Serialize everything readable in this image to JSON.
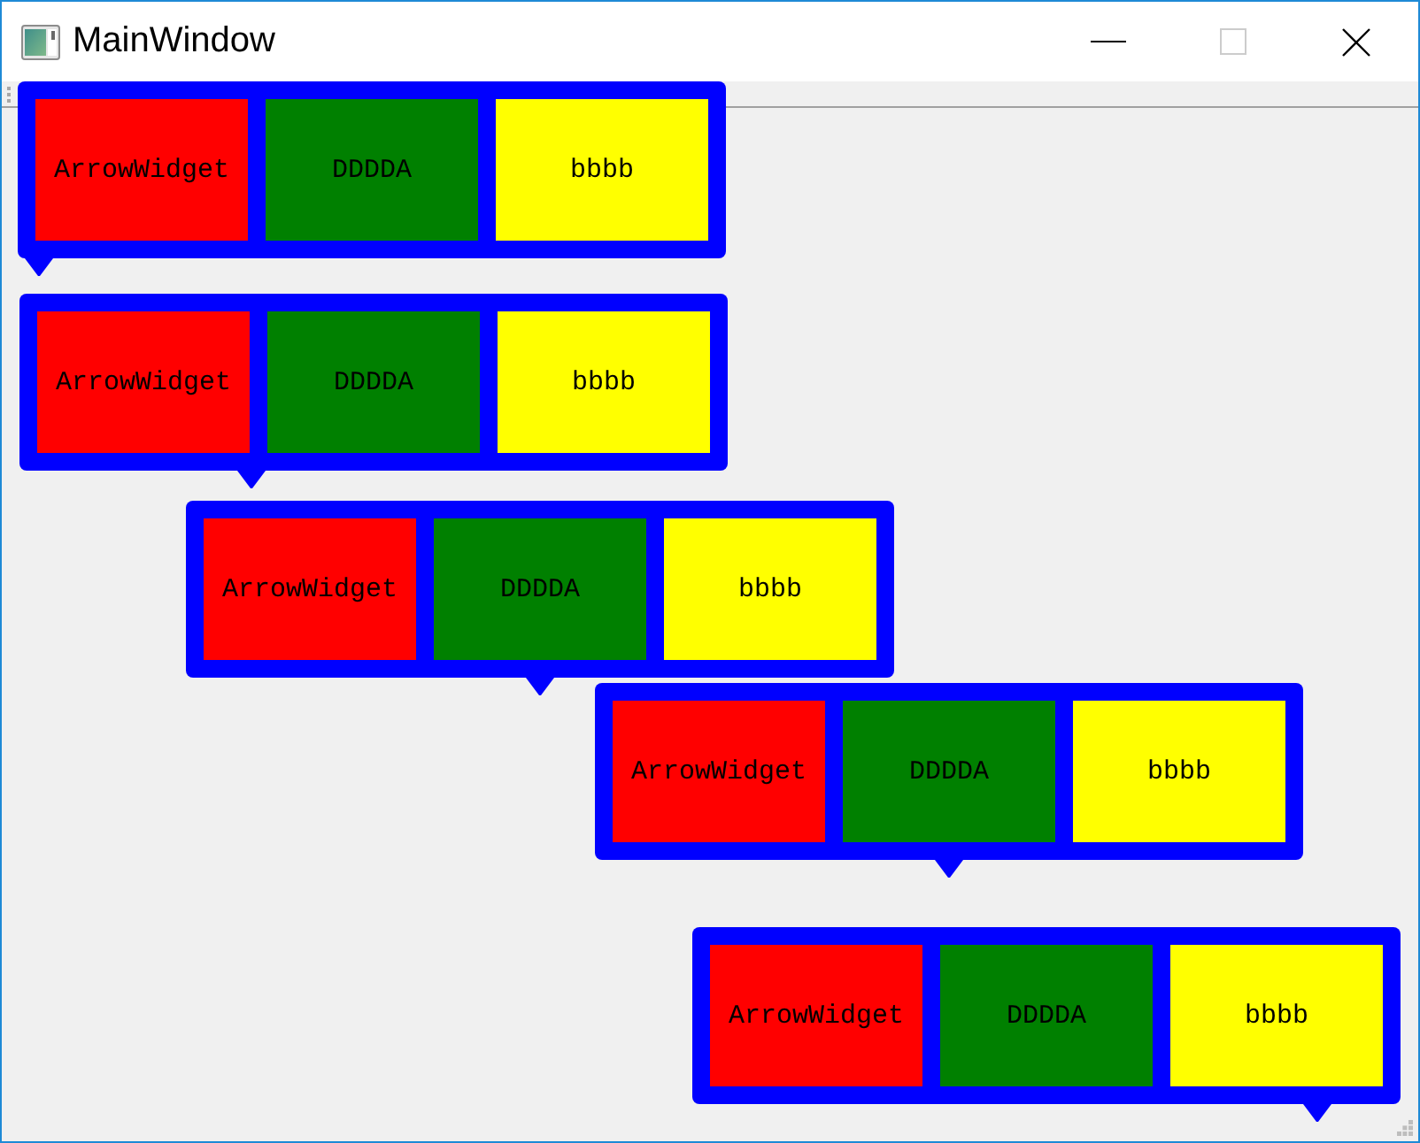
{
  "window": {
    "title": "MainWindow",
    "buttons": [
      {
        "kind": "minimize",
        "disabled": false
      },
      {
        "kind": "maximize",
        "disabled": true
      },
      {
        "kind": "close",
        "disabled": false
      }
    ]
  },
  "widgets": [
    {
      "cells": [
        {
          "text": "ArrowWidget",
          "color": "#ff0000"
        },
        {
          "text": "DDDDA",
          "color": "#008000"
        },
        {
          "text": "bbbb",
          "color": "#ffff00"
        }
      ]
    },
    {
      "cells": [
        {
          "text": "ArrowWidget",
          "color": "#ff0000"
        },
        {
          "text": "DDDDA",
          "color": "#008000"
        },
        {
          "text": "bbbb",
          "color": "#ffff00"
        }
      ]
    },
    {
      "cells": [
        {
          "text": "ArrowWidget",
          "color": "#ff0000"
        },
        {
          "text": "DDDDA",
          "color": "#008000"
        },
        {
          "text": "bbbb",
          "color": "#ffff00"
        }
      ]
    },
    {
      "cells": [
        {
          "text": "ArrowWidget",
          "color": "#ff0000"
        },
        {
          "text": "DDDDA",
          "color": "#008000"
        },
        {
          "text": "bbbb",
          "color": "#ffff00"
        }
      ]
    },
    {
      "cells": [
        {
          "text": "ArrowWidget",
          "color": "#ff0000"
        },
        {
          "text": "DDDDA",
          "color": "#008000"
        },
        {
          "text": "bbbb",
          "color": "#ffff00"
        }
      ]
    }
  ]
}
